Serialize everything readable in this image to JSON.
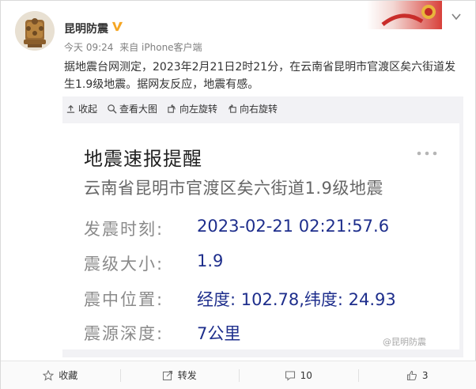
{
  "user": {
    "name": "昆明防震",
    "time": "今天 09:24",
    "source": "来自 iPhone客户端"
  },
  "post": {
    "text": "据地震台网测定，2023年2月21日2时21分，在云南省昆明市官渡区矣六街道发生1.9级地震。据网友反应，地震有感。"
  },
  "media_toolbar": {
    "collapse": "收起",
    "view_large": "查看大图",
    "rotate_left": "向左旋转",
    "rotate_right": "向右旋转"
  },
  "card": {
    "title": "地震速报提醒",
    "subtitle": "云南省昆明市官渡区矣六街道1.9级地震",
    "rows": [
      {
        "label": "发震时刻:",
        "value": "2023-02-21 02:21:57.6"
      },
      {
        "label": "震级大小:",
        "value": "1.9"
      },
      {
        "label": "震中位置:",
        "value": "经度: 102.78,纬度: 24.93"
      },
      {
        "label": "震源深度:",
        "value": "7公里"
      }
    ],
    "watermark": "@昆明防震"
  },
  "footer": {
    "favorite": "收藏",
    "repost": "转发",
    "comments": "10",
    "likes": "3"
  },
  "colors": {
    "value_blue": "#1e2e8c",
    "verified": "#f5a623",
    "media_bg": "#f2f2f5"
  }
}
